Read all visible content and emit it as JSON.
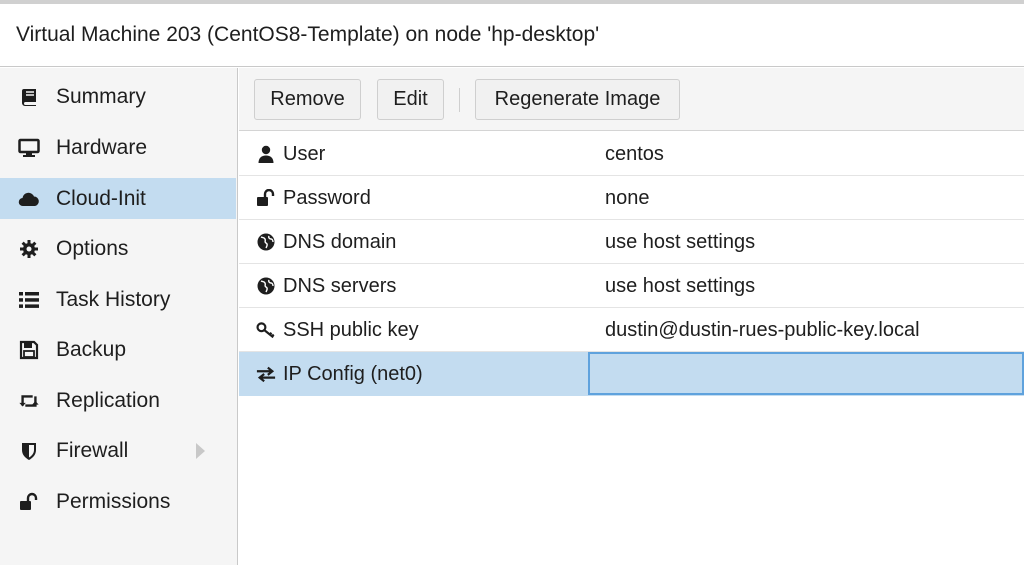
{
  "window": {
    "title": "Virtual Machine 203 (CentOS8-Template) on node 'hp-desktop'"
  },
  "sidebar": {
    "items": [
      {
        "label": "Summary",
        "icon": "book-icon",
        "active": false
      },
      {
        "label": "Hardware",
        "icon": "monitor-icon",
        "active": false
      },
      {
        "label": "Cloud-Init",
        "icon": "cloud-icon",
        "active": true
      },
      {
        "label": "Options",
        "icon": "gear-icon",
        "active": false
      },
      {
        "label": "Task History",
        "icon": "list-icon",
        "active": false
      },
      {
        "label": "Backup",
        "icon": "floppy-icon",
        "active": false
      },
      {
        "label": "Replication",
        "icon": "retweet-icon",
        "active": false
      },
      {
        "label": "Firewall",
        "icon": "shield-icon",
        "active": false
      },
      {
        "label": "Permissions",
        "icon": "unlock-icon",
        "active": false
      }
    ]
  },
  "toolbar": {
    "remove_label": "Remove",
    "edit_label": "Edit",
    "regenerate_label": "Regenerate Image"
  },
  "cloudinit": {
    "rows": [
      {
        "key": "User",
        "value": "centos",
        "icon": "user-icon"
      },
      {
        "key": "Password",
        "value": "none",
        "icon": "unlock-icon"
      },
      {
        "key": "DNS domain",
        "value": "use host settings",
        "icon": "globe-icon"
      },
      {
        "key": "DNS servers",
        "value": "use host settings",
        "icon": "globe-icon"
      },
      {
        "key": "SSH public key",
        "value": "dustin@dustin-rues-public-key.local",
        "icon": "key-icon"
      },
      {
        "key": "IP Config (net0)",
        "value": "",
        "icon": "exchange-icon",
        "selected": true
      }
    ]
  },
  "colors": {
    "selection": "#c3dcf0",
    "focus_border": "#5fa2dd"
  }
}
